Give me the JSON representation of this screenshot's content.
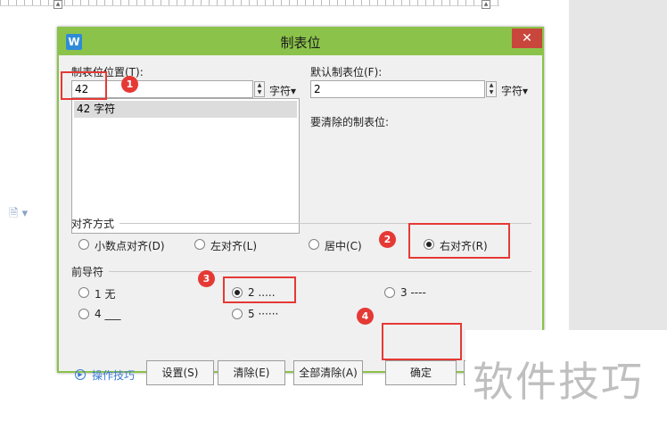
{
  "dialog": {
    "title": "制表位",
    "close_glyph": "✕",
    "logo_letter": "W",
    "tab_position_label": "制表位位置(T):",
    "tab_position_value": "42",
    "tab_unit": "字符▾",
    "default_tab_label": "默认制表位(F):",
    "default_tab_value": "2",
    "default_unit": "字符▾",
    "clear_label": "要清除的制表位:",
    "list_items": [
      "42 字符"
    ],
    "align_label": "对齐方式",
    "align_options": [
      "小数点对齐(D)",
      "左对齐(L)",
      "居中(C)",
      "右对齐(R)"
    ],
    "align_selected": "右对齐(R)",
    "leader_label": "前导符",
    "leader_options": [
      "1 无",
      "2 .....",
      "3 ----",
      "4 ___",
      "5 ······"
    ],
    "leader_selected": "2 .....",
    "tip_link": "操作技巧",
    "buttons": {
      "set": "设置(S)",
      "clear": "清除(E)",
      "clear_all": "全部清除(A)",
      "ok": "确定"
    }
  },
  "annotations": [
    "1",
    "2",
    "3",
    "4"
  ],
  "watermark": "软件技巧",
  "colors": {
    "dialog_frame": "#8bc34a",
    "close_button": "#c9463d",
    "annotation": "#e53935",
    "link": "#3a7bd5"
  },
  "icons": [
    "wps-logo-icon",
    "close-icon",
    "spinner-icon",
    "radio-icon",
    "help-circle-icon",
    "document-icon"
  ]
}
